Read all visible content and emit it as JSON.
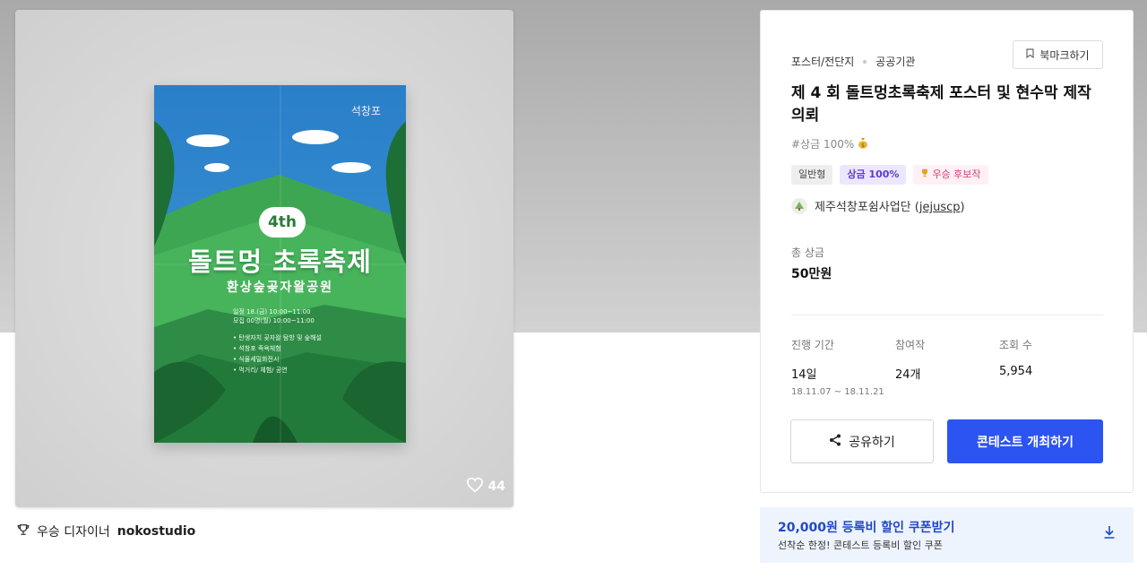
{
  "gallery": {
    "like_count": "44",
    "poster": {
      "brand": "석창포",
      "edition": "4th",
      "title": "돌트멍 초록축제",
      "subtitle": "환상숲곶자왈공원",
      "info_lines": [
        "일정 18.(금) 10:00~11:00",
        "모집 00명(월) 10:00~11:00"
      ],
      "list_items": [
        "• 탄생자치 곶자왈 탐방 및 숲해설",
        "• 석창포 족욕체험",
        "• 식물세밀화전시",
        "• 먹거리/ 체험/ 공연"
      ]
    }
  },
  "winner": {
    "label": "우승 디자이너",
    "name": "nokostudio"
  },
  "contest": {
    "category": "포스터/전단지",
    "org_type": "공공기관",
    "bookmark_label": "북마크하기",
    "title": "제 4 회 돌트멍초록축제 포스터 및 현수막 제작의뢰",
    "tagline": "#상금 100%",
    "badges": [
      "일반형",
      "상금 100%",
      "우승 후보작"
    ],
    "host_name": "제주석창포쉼사업단",
    "host_id": "jejuscp",
    "prize_label": "총 상금",
    "prize_value": "50만원",
    "stats": {
      "period_label": "진행 기간",
      "period_value": "14일",
      "period_range": "18.11.07 ~ 18.11.21",
      "participants_label": "참여작",
      "participants_value": "24개",
      "views_label": "조회 수",
      "views_value": "5,954"
    },
    "share_label": "공유하기",
    "host_contest_label": "콘테스트 개최하기"
  },
  "coupon": {
    "title": "20,000원 등록비 할인 쿠폰받기",
    "subtitle": "선착순 한정! 콘테스트 등록비 할인 쿠폰"
  },
  "colors": {
    "primary": "#2b54f0",
    "coupon_bg": "#eef4fe",
    "coupon_text": "#2148c9"
  }
}
